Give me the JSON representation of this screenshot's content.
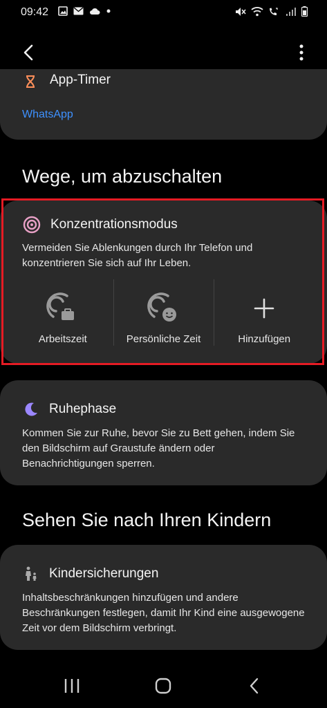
{
  "status": {
    "time": "09:42"
  },
  "top_card": {
    "title": "App-Timer",
    "subtitle": "WhatsApp"
  },
  "sections": {
    "ways": "Wege, um abzuschalten",
    "kids": "Sehen Sie nach Ihren Kindern"
  },
  "focus": {
    "title": "Konzentrationsmodus",
    "description": "Vermeiden Sie Ablenkungen durch Ihr Telefon und konzentrieren Sie sich auf Ihr Leben.",
    "modes": [
      {
        "label": "Arbeitszeit",
        "icon": "work-focus-icon"
      },
      {
        "label": "Persönliche Zeit",
        "icon": "personal-focus-icon"
      },
      {
        "label": "Hinzufügen",
        "icon": "add-icon"
      }
    ]
  },
  "rest": {
    "title": "Ruhephase",
    "description": "Kommen Sie zur Ruhe, bevor Sie zu Bett gehen, indem Sie den Bildschirm auf Graustufe ändern oder Benachrichtigungen sperren."
  },
  "kids": {
    "title": "Kindersicherungen",
    "description": "Inhaltsbeschränkungen hinzufügen und andere Beschränkungen festlegen, damit Ihr Kind eine ausgewogene Zeit vor dem Bildschirm verbringt."
  },
  "colors": {
    "link": "#3e91ff",
    "highlight": "#e51b24",
    "focus_icon": "#e8a0c6",
    "moon": "#9b87ff",
    "hourglass": "#ff8f5a"
  }
}
